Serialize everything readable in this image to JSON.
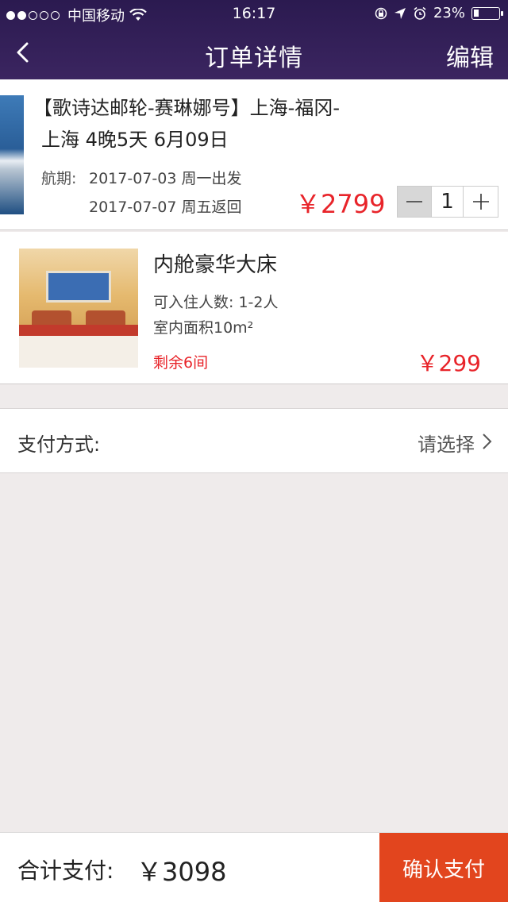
{
  "status_bar": {
    "carrier": "中国移动",
    "time": "16:17",
    "battery": "23%"
  },
  "nav": {
    "title": "订单详情",
    "edit_label": "编辑"
  },
  "cruise": {
    "name_line1": "【歌诗达邮轮-赛琳娜号】上海-福冈-",
    "name_line2": "上海 4晚5天 6月09日",
    "voyage_label": "航期:",
    "departure": "2017-07-03 周一出发",
    "return": "2017-07-07 周五返回",
    "price": "￥2799",
    "quantity": "1"
  },
  "cabin": {
    "title": "内舱豪华大床",
    "capacity": "可入住人数: 1-2人",
    "area": "室内面积10m²",
    "remaining": "剩余6间",
    "price": "￥299"
  },
  "payment": {
    "label": "支付方式:",
    "placeholder": "请选择"
  },
  "footer": {
    "total_label": "合计支付:",
    "total": "￥3098",
    "confirm_label": "确认支付"
  },
  "colors": {
    "header": "#2b1a50",
    "price_red": "#e8242a",
    "confirm": "#e2451e"
  }
}
